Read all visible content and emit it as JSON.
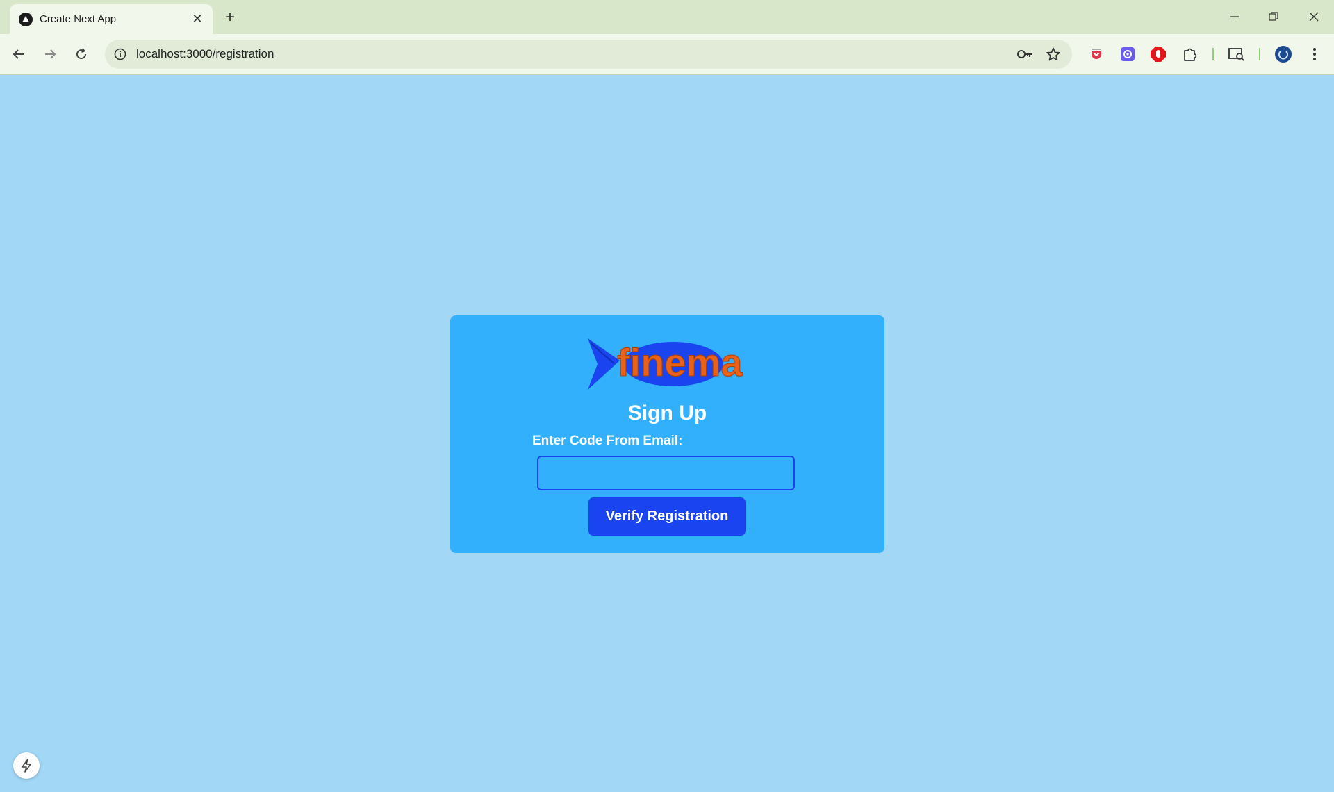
{
  "browser": {
    "tab": {
      "title": "Create Next App",
      "close_glyph": "✕",
      "favicon": "nextjs-triangle-icon"
    },
    "new_tab_glyph": "+",
    "window_controls": {
      "minimize": "—",
      "restore": "❐",
      "close": "✕"
    },
    "nav": {
      "back": "←",
      "forward": "→",
      "reload": "↻"
    },
    "address_bar": {
      "url": "localhost:3000/registration"
    },
    "address_icons": [
      "key-icon",
      "star-icon"
    ],
    "extensions": [
      "pocket-icon",
      "extension-purple-icon",
      "adblock-icon",
      "puzzle-icon",
      "tab-search-icon",
      "profile-avatar"
    ],
    "menu_glyph": "⋮"
  },
  "page": {
    "logo_text": "finema",
    "title": "Sign Up",
    "code_label": "Enter Code From Email:",
    "code_value": "",
    "verify_button": "Verify Registration"
  },
  "colors": {
    "page_bg": "#a3d7f6",
    "card_bg": "#33b0fc",
    "button_bg": "#1a44f0",
    "logo_fish": "#1a44f0",
    "logo_text": "#e8621a"
  }
}
